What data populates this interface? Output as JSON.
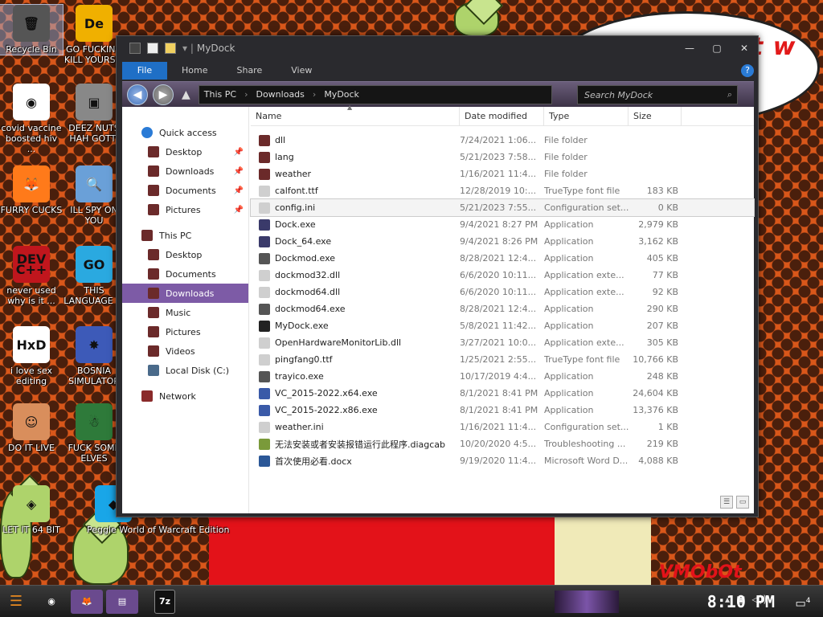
{
  "desktop": {
    "icons": [
      {
        "label": "Recycle Bin",
        "glyph": "🗑",
        "bg": "#555"
      },
      {
        "label": "GO FUCKING KILL YOURS...",
        "glyph": "De",
        "bg": "#f0b000"
      },
      {
        "label": "covid vaccine boosted hiv ...",
        "glyph": "◉",
        "bg": "#ffffff"
      },
      {
        "label": "DEEZ NUTS HAH GOTTI",
        "glyph": "▣",
        "bg": "#888"
      },
      {
        "label": "FURRY CUCKS",
        "glyph": "🦊",
        "bg": "#ff7a1a"
      },
      {
        "label": "ILL SPY ON YOU",
        "glyph": "🔍",
        "bg": "#6aa0d8"
      },
      {
        "label": "never used why is it ...",
        "glyph": "DEV C++",
        "bg": "#c0161d"
      },
      {
        "label": "THIS LANGUAGE ...",
        "glyph": "GO",
        "bg": "#2aa9e0"
      },
      {
        "label": "i love sex editing",
        "glyph": "HxD",
        "bg": "#ffffff"
      },
      {
        "label": "BOSNIA SIMULATOR",
        "glyph": "✸",
        "bg": "#3d5ab8"
      },
      {
        "label": "DO IT LIVE",
        "glyph": "☺",
        "bg": "#d98e5c"
      },
      {
        "label": "FUCK SOME ELVES",
        "glyph": "☃",
        "bg": "#2e7a3a"
      },
      {
        "label": "LET IT 64 BIT",
        "glyph": "◈",
        "bg": "#aed36b"
      },
      {
        "label": "Peggle World of Warcraft Edition",
        "glyph": "◆",
        "bg": "#19a6e8"
      }
    ],
    "bubble_text": "ithy  this  hit    w",
    "watermark": "VMObOt"
  },
  "window": {
    "title": "MyDock",
    "ribbon_tabs": [
      "File",
      "Home",
      "Share",
      "View"
    ],
    "breadcrumb": [
      "This PC",
      "Downloads",
      "MyDock"
    ],
    "search_placeholder": "Search MyDock",
    "nav": [
      {
        "label": "Quick access",
        "icon": "star-icon",
        "color": "#2a7bd6",
        "indent": 0,
        "pinned": false,
        "selected": false
      },
      {
        "label": "Desktop",
        "icon": "desktop-icon",
        "color": "#6b2a2a",
        "indent": 1,
        "pinned": true,
        "selected": false
      },
      {
        "label": "Downloads",
        "icon": "downloads-icon",
        "color": "#6b2a2a",
        "indent": 1,
        "pinned": true,
        "selected": false
      },
      {
        "label": "Documents",
        "icon": "documents-icon",
        "color": "#6b2a2a",
        "indent": 1,
        "pinned": true,
        "selected": false
      },
      {
        "label": "Pictures",
        "icon": "pictures-icon",
        "color": "#6b2a2a",
        "indent": 1,
        "pinned": true,
        "selected": false
      },
      {
        "label": "This PC",
        "icon": "this-pc-icon",
        "color": "#6b2a2a",
        "indent": 0,
        "pinned": false,
        "selected": false
      },
      {
        "label": "Desktop",
        "icon": "desktop-icon",
        "color": "#6b2a2a",
        "indent": 1,
        "pinned": false,
        "selected": false
      },
      {
        "label": "Documents",
        "icon": "documents-icon",
        "color": "#6b2a2a",
        "indent": 1,
        "pinned": false,
        "selected": false
      },
      {
        "label": "Downloads",
        "icon": "downloads-icon",
        "color": "#6b2a2a",
        "indent": 1,
        "pinned": false,
        "selected": true
      },
      {
        "label": "Music",
        "icon": "music-icon",
        "color": "#6b2a2a",
        "indent": 1,
        "pinned": false,
        "selected": false
      },
      {
        "label": "Pictures",
        "icon": "pictures-icon",
        "color": "#6b2a2a",
        "indent": 1,
        "pinned": false,
        "selected": false
      },
      {
        "label": "Videos",
        "icon": "videos-icon",
        "color": "#6b2a2a",
        "indent": 1,
        "pinned": false,
        "selected": false
      },
      {
        "label": "Local Disk (C:)",
        "icon": "disk-icon",
        "color": "#4a6a8a",
        "indent": 1,
        "pinned": false,
        "selected": false
      },
      {
        "label": "Network",
        "icon": "network-icon",
        "color": "#8a2a2a",
        "indent": 0,
        "pinned": false,
        "selected": false
      }
    ],
    "columns": [
      "Name",
      "Date modified",
      "Type",
      "Size"
    ],
    "files": [
      {
        "name": "dll",
        "date": "7/24/2021 1:06...",
        "type": "File folder",
        "size": "",
        "icon": "folder-icon",
        "color": "#6b2a2a"
      },
      {
        "name": "lang",
        "date": "5/21/2023 7:58...",
        "type": "File folder",
        "size": "",
        "icon": "folder-icon",
        "color": "#6b2a2a"
      },
      {
        "name": "weather",
        "date": "1/16/2021 11:4...",
        "type": "File folder",
        "size": "",
        "icon": "folder-icon",
        "color": "#6b2a2a"
      },
      {
        "name": "calfont.ttf",
        "date": "12/28/2019 10:...",
        "type": "TrueType font file",
        "size": "183 KB",
        "icon": "font-file-icon",
        "color": "#cfcfcf"
      },
      {
        "name": "config.ini",
        "date": "5/21/2023 7:55...",
        "type": "Configuration set...",
        "size": "0 KB",
        "icon": "settings-file-icon",
        "color": "#cfcfcf"
      },
      {
        "name": "Dock.exe",
        "date": "9/4/2021 8:27 PM",
        "type": "Application",
        "size": "2,979 KB",
        "icon": "app-icon",
        "color": "#3a3a6a"
      },
      {
        "name": "Dock_64.exe",
        "date": "9/4/2021 8:26 PM",
        "type": "Application",
        "size": "3,162 KB",
        "icon": "app-icon",
        "color": "#3a3a6a"
      },
      {
        "name": "Dockmod.exe",
        "date": "8/28/2021 12:4...",
        "type": "Application",
        "size": "405 KB",
        "icon": "tools-icon",
        "color": "#555555"
      },
      {
        "name": "dockmod32.dll",
        "date": "6/6/2020 10:11...",
        "type": "Application exte...",
        "size": "77 KB",
        "icon": "dll-icon",
        "color": "#cfcfcf"
      },
      {
        "name": "dockmod64.dll",
        "date": "6/6/2020 10:11...",
        "type": "Application exte...",
        "size": "92 KB",
        "icon": "dll-icon",
        "color": "#cfcfcf"
      },
      {
        "name": "dockmod64.exe",
        "date": "8/28/2021 12:4...",
        "type": "Application",
        "size": "290 KB",
        "icon": "tools-icon",
        "color": "#555555"
      },
      {
        "name": "MyDock.exe",
        "date": "5/8/2021 11:42...",
        "type": "Application",
        "size": "207 KB",
        "icon": "app-icon",
        "color": "#222222"
      },
      {
        "name": "OpenHardwareMonitorLib.dll",
        "date": "3/27/2021 10:0...",
        "type": "Application exte...",
        "size": "305 KB",
        "icon": "dll-icon",
        "color": "#cfcfcf"
      },
      {
        "name": "pingfang0.ttf",
        "date": "1/25/2021 2:55...",
        "type": "TrueType font file",
        "size": "10,766 KB",
        "icon": "font-file-icon",
        "color": "#cfcfcf"
      },
      {
        "name": "trayico.exe",
        "date": "10/17/2019 4:4...",
        "type": "Application",
        "size": "248 KB",
        "icon": "tools-icon",
        "color": "#555555"
      },
      {
        "name": "VC_2015-2022.x64.exe",
        "date": "8/1/2021 8:41 PM",
        "type": "Application",
        "size": "24,604 KB",
        "icon": "installer-icon",
        "color": "#3a5aa8"
      },
      {
        "name": "VC_2015-2022.x86.exe",
        "date": "8/1/2021 8:41 PM",
        "type": "Application",
        "size": "13,376 KB",
        "icon": "installer-icon",
        "color": "#3a5aa8"
      },
      {
        "name": "weather.ini",
        "date": "1/16/2021 11:4...",
        "type": "Configuration set...",
        "size": "1 KB",
        "icon": "settings-file-icon",
        "color": "#cfcfcf"
      },
      {
        "name": "无法安装或者安装报错运行此程序.diagcab",
        "date": "10/20/2020 4:5...",
        "type": "Troubleshooting ...",
        "size": "219 KB",
        "icon": "diagcab-icon",
        "color": "#7a9a3a"
      },
      {
        "name": "首次使用必看.docx",
        "date": "9/19/2020 11:4...",
        "type": "Microsoft Word D...",
        "size": "4,088 KB",
        "icon": "word-doc-icon",
        "color": "#2b5797"
      }
    ],
    "selected_file_index": 4
  },
  "taskbar": {
    "apps": [
      {
        "name": "chrome",
        "glyph": "◉",
        "bg": "#3a3a3a",
        "active": false
      },
      {
        "name": "firefox",
        "glyph": "🦊",
        "bg": "#6a4a8e",
        "active": true
      },
      {
        "name": "file-explorer",
        "glyph": "▤",
        "bg": "#6a4a8e",
        "active": true
      },
      {
        "name": "7-zip",
        "glyph": "7z",
        "bg": "#111",
        "active": false
      }
    ],
    "clock": "8:10 PM",
    "notification_count": "4"
  }
}
